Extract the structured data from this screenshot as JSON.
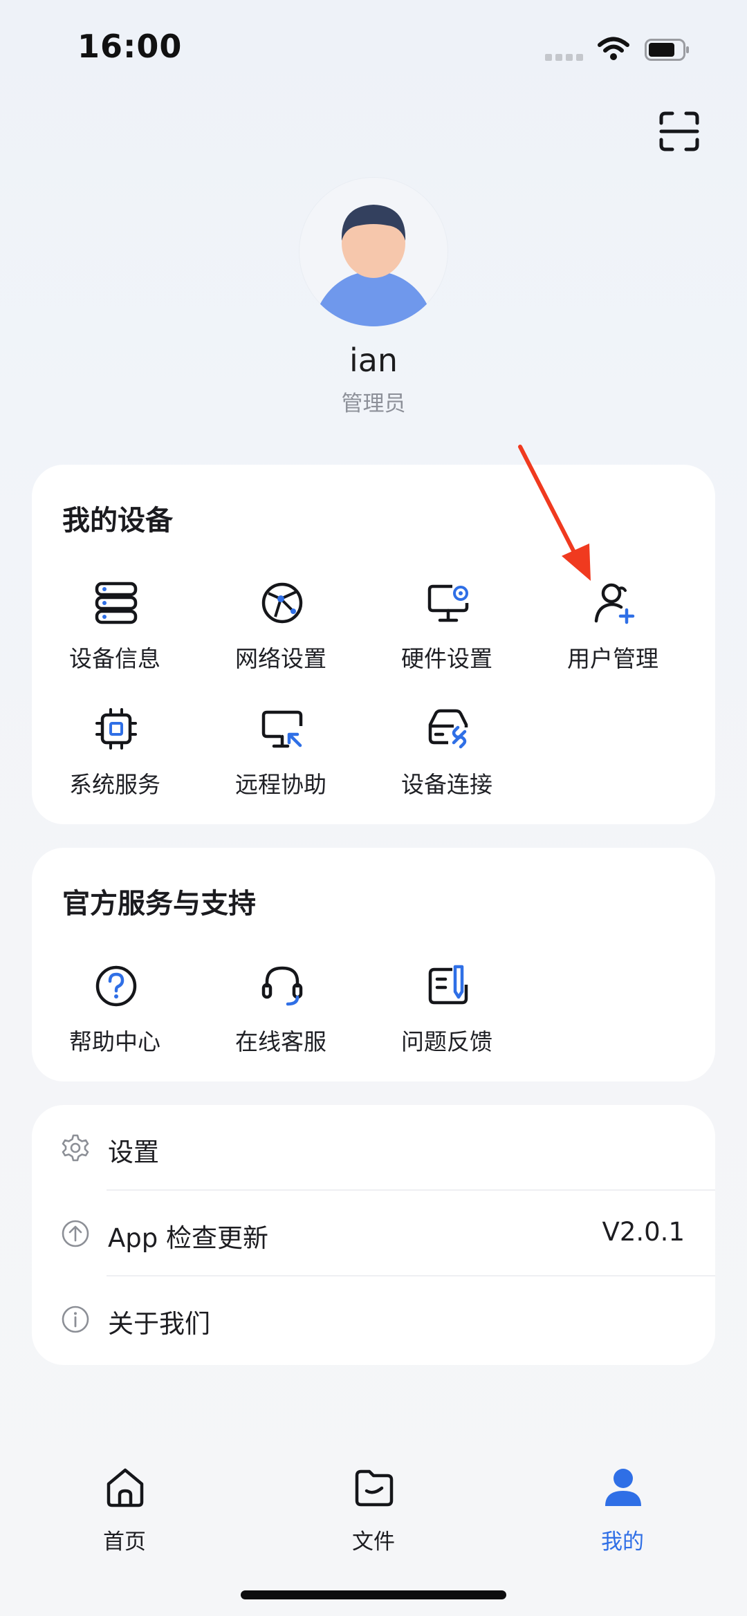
{
  "status_bar": {
    "time": "16:00"
  },
  "header": {
    "scan_icon": "scan-icon"
  },
  "profile": {
    "name": "ian",
    "role": "管理员",
    "avatar_icon": "user-avatar"
  },
  "my_devices": {
    "title": "我的设备",
    "items": [
      {
        "label": "设备信息",
        "icon": "server-stack-icon"
      },
      {
        "label": "网络设置",
        "icon": "network-globe-icon"
      },
      {
        "label": "硬件设置",
        "icon": "monitor-gear-icon"
      },
      {
        "label": "用户管理",
        "icon": "user-add-icon"
      },
      {
        "label": "系统服务",
        "icon": "cpu-chip-icon"
      },
      {
        "label": "远程协助",
        "icon": "remote-desktop-icon"
      },
      {
        "label": "设备连接",
        "icon": "drive-link-icon"
      }
    ]
  },
  "support": {
    "title": "官方服务与支持",
    "items": [
      {
        "label": "帮助中心",
        "icon": "help-circle-icon"
      },
      {
        "label": "在线客服",
        "icon": "headset-icon"
      },
      {
        "label": "问题反馈",
        "icon": "feedback-note-icon"
      }
    ]
  },
  "settings_list": {
    "rows": [
      {
        "label": "设置",
        "icon": "gear-icon"
      },
      {
        "label": "App 检查更新",
        "value": "V2.0.1",
        "icon": "upload-circle-icon"
      },
      {
        "label": "关于我们",
        "icon": "info-circle-icon"
      }
    ]
  },
  "tab_bar": {
    "tabs": [
      {
        "label": "首页",
        "icon": "home-icon",
        "active": false
      },
      {
        "label": "文件",
        "icon": "folder-icon",
        "active": false
      },
      {
        "label": "我的",
        "icon": "person-icon",
        "active": true
      }
    ]
  },
  "colors": {
    "accent": "#2f6fe6",
    "annotation_arrow": "#f03a1f",
    "card": "#ffffff"
  }
}
